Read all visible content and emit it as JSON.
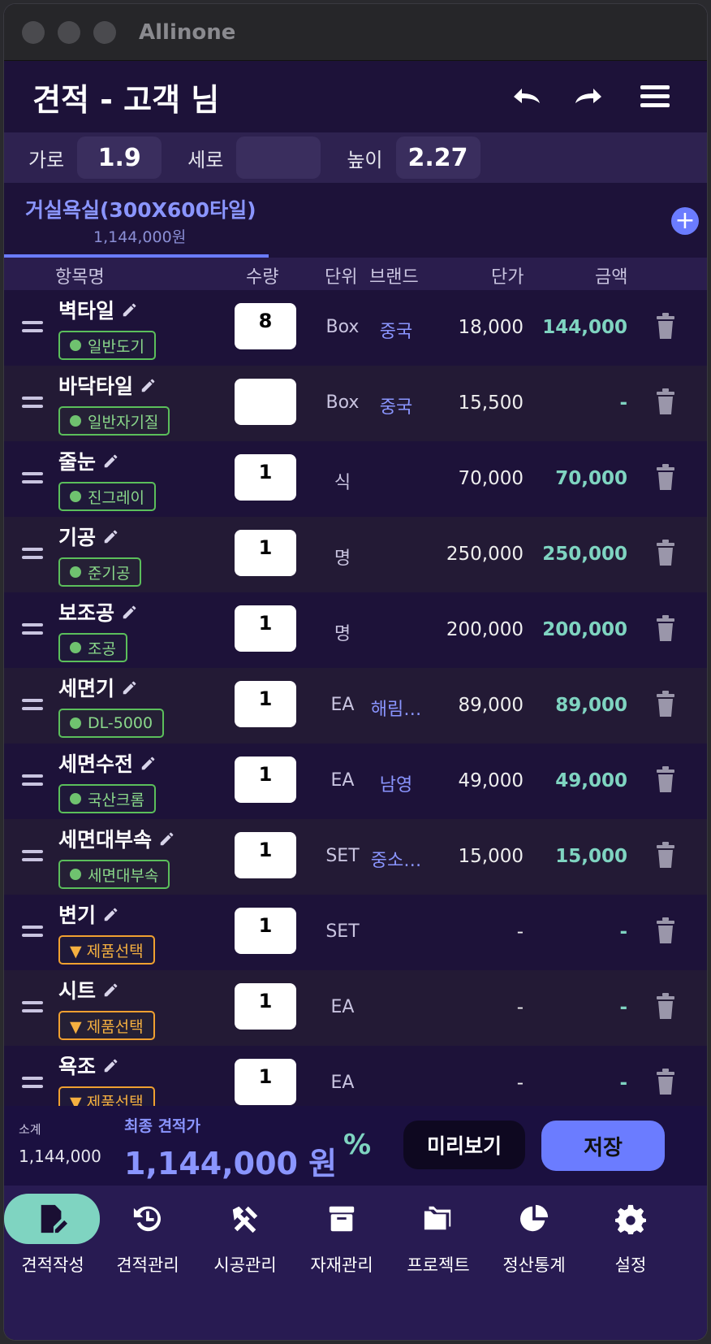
{
  "window": {
    "title": "Allinone"
  },
  "header": {
    "title": "견적 - 고객 님"
  },
  "dimensions": {
    "width_label": "가로",
    "width_value": "1.9",
    "depth_label": "세로",
    "depth_value": "",
    "height_label": "높이",
    "height_value": "2.27"
  },
  "section": {
    "title": "거실욕실(300X600타일)",
    "total": "1,144,000원"
  },
  "columns": {
    "name": "항목명",
    "qty": "수량",
    "unit": "단위",
    "brand": "브랜드",
    "price": "단가",
    "amount": "금액"
  },
  "items": [
    {
      "name": "벽타일",
      "tag": "일반도기",
      "tag_type": "ok",
      "qty": "8",
      "unit": "Box",
      "brand": "중국",
      "price": "18,000",
      "amount": "144,000"
    },
    {
      "name": "바닥타일",
      "tag": "일반자기질",
      "tag_type": "ok",
      "qty": "",
      "unit": "Box",
      "brand": "중국",
      "price": "15,500",
      "amount": "-"
    },
    {
      "name": "줄눈",
      "tag": "진그레이",
      "tag_type": "ok",
      "qty": "1",
      "unit": "식",
      "brand": "",
      "price": "70,000",
      "amount": "70,000"
    },
    {
      "name": "기공",
      "tag": "준기공",
      "tag_type": "ok",
      "qty": "1",
      "unit": "명",
      "brand": "",
      "price": "250,000",
      "amount": "250,000"
    },
    {
      "name": "보조공",
      "tag": "조공",
      "tag_type": "ok",
      "qty": "1",
      "unit": "명",
      "brand": "",
      "price": "200,000",
      "amount": "200,000"
    },
    {
      "name": "세면기",
      "tag": "DL-5000",
      "tag_type": "ok",
      "qty": "1",
      "unit": "EA",
      "brand": "해림…",
      "price": "89,000",
      "amount": "89,000"
    },
    {
      "name": "세면수전",
      "tag": "국산크롬",
      "tag_type": "ok",
      "qty": "1",
      "unit": "EA",
      "brand": "남영",
      "price": "49,000",
      "amount": "49,000"
    },
    {
      "name": "세면대부속",
      "tag": "세면대부속",
      "tag_type": "ok",
      "qty": "1",
      "unit": "SET",
      "brand": "중소…",
      "price": "15,000",
      "amount": "15,000"
    },
    {
      "name": "변기",
      "tag": "▼ 제품선택",
      "tag_type": "warn",
      "qty": "1",
      "unit": "SET",
      "brand": "",
      "price": "-",
      "amount": "-"
    },
    {
      "name": "시트",
      "tag": "▼ 제품선택",
      "tag_type": "warn",
      "qty": "1",
      "unit": "EA",
      "brand": "",
      "price": "-",
      "amount": "-"
    },
    {
      "name": "욕조",
      "tag": "▼ 제품선택",
      "tag_type": "warn",
      "qty": "1",
      "unit": "EA",
      "brand": "",
      "price": "-",
      "amount": "-"
    }
  ],
  "summary": {
    "subtotal_label": "소계",
    "subtotal_value": "1,144,000",
    "final_label": "최종 견적가",
    "final_value": "1,144,000 원",
    "percent_symbol": "%",
    "preview_label": "미리보기",
    "save_label": "저장"
  },
  "tabs": [
    {
      "label": "견적작성",
      "icon": "edit-document-icon",
      "active": true
    },
    {
      "label": "견적관리",
      "icon": "history-icon",
      "active": false
    },
    {
      "label": "시공관리",
      "icon": "tools-icon",
      "active": false
    },
    {
      "label": "자재관리",
      "icon": "archive-box-icon",
      "active": false
    },
    {
      "label": "프로젝트",
      "icon": "folders-icon",
      "active": false
    },
    {
      "label": "정산통계",
      "icon": "pie-chart-icon",
      "active": false
    },
    {
      "label": "설정",
      "icon": "gear-icon",
      "active": false
    }
  ],
  "colors": {
    "accent": "#6b7cff",
    "amount": "#7fd4c1",
    "ok_tag": "#5bbf5b",
    "warn_tag": "#f0a030",
    "background": "#1a0f33"
  }
}
